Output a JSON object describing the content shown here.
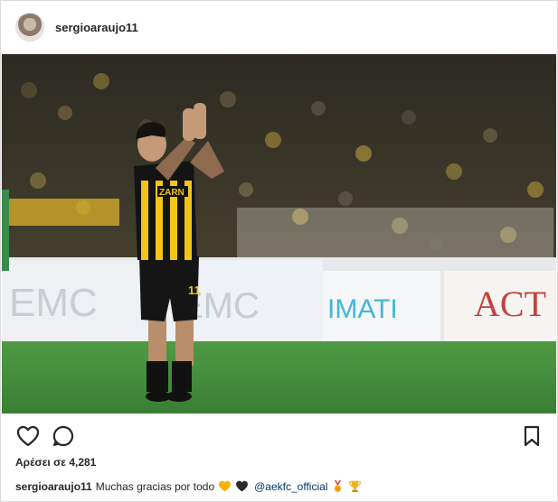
{
  "post": {
    "username": "sergioaraujo11",
    "likes_text": "Αρέσει σε 4,281",
    "caption": {
      "username": "sergioaraujo11",
      "text": "Muchas gracias por todo",
      "mention": "@aekfc_official"
    }
  },
  "photo": {
    "banners": [
      "EMC",
      "EMC",
      "IMATI",
      "ACT"
    ],
    "jersey_number": "11",
    "sponsor": "ZARN"
  },
  "icons": {
    "like": "heart-icon",
    "comment": "comment-icon",
    "save": "bookmark-icon",
    "emojis": [
      "yellow-heart-icon",
      "black-heart-icon",
      "medal-icon",
      "trophy-icon"
    ]
  },
  "colors": {
    "username": "#262626",
    "mention": "#003569",
    "border": "#dbdbdb",
    "pitch": "#3f8a3a",
    "jersey_yellow": "#f2c418"
  }
}
